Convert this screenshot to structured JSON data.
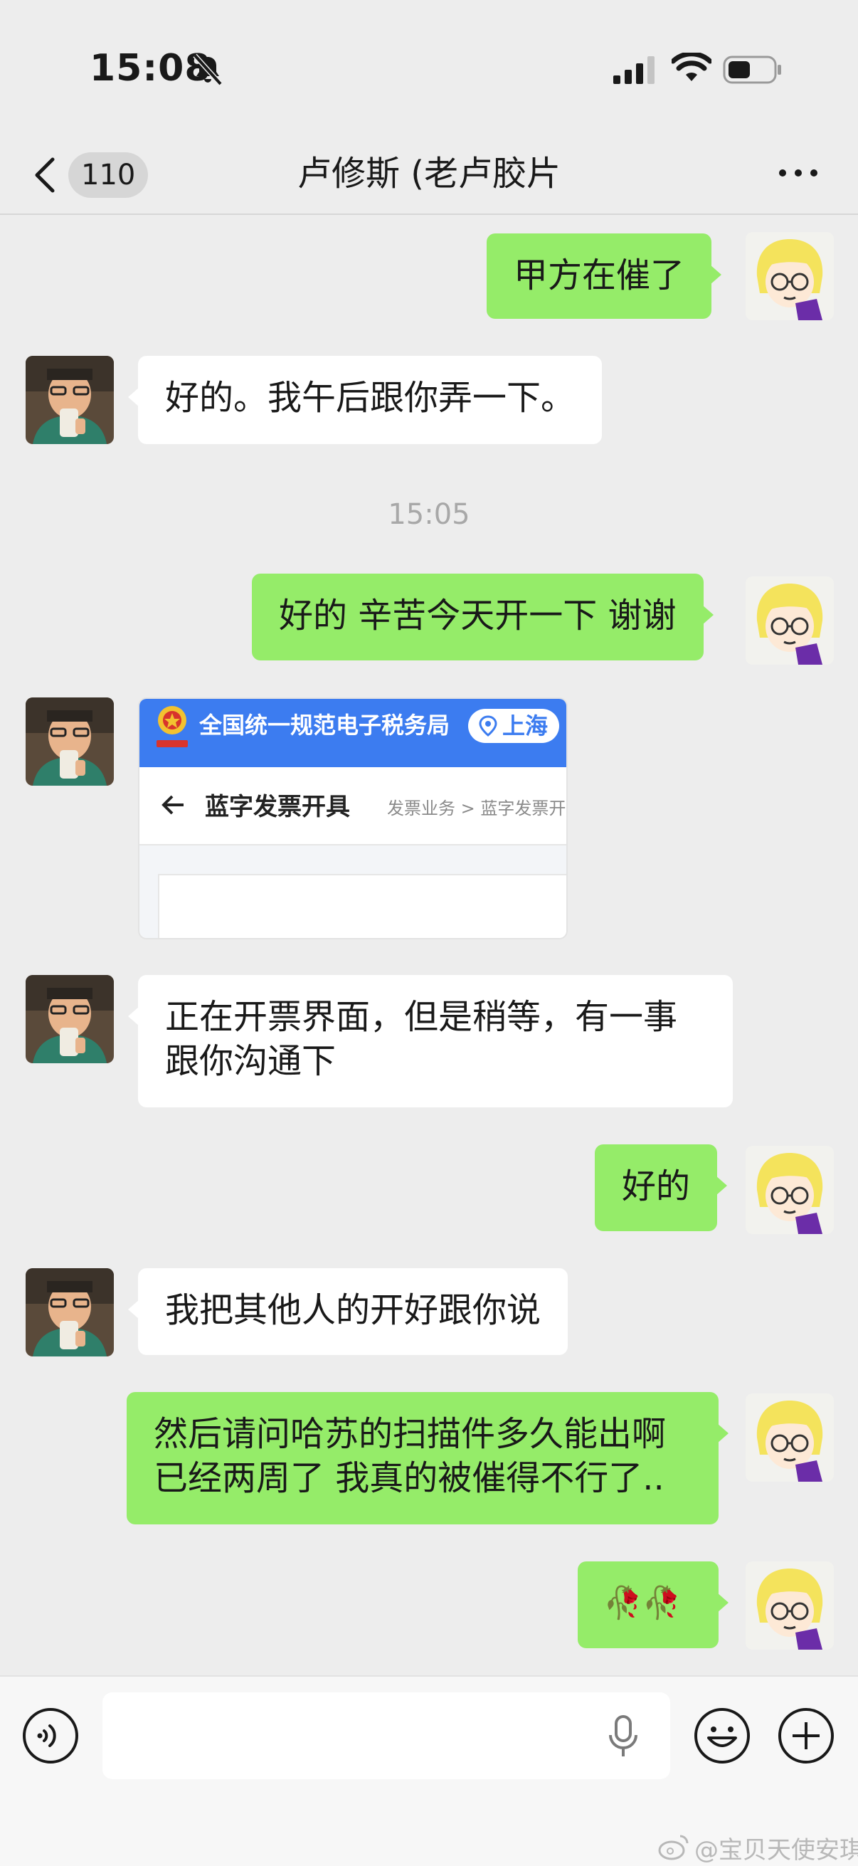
{
  "status_bar": {
    "time": "15:08"
  },
  "header": {
    "unread_count": "110",
    "title": "卢修斯 (老卢胶片"
  },
  "messages": [
    {
      "from": "me",
      "text": "甲方在催了"
    },
    {
      "from": "contact",
      "text": "好的。我午后跟你弄一下。"
    },
    {
      "type": "timestamp",
      "text": "15:05"
    },
    {
      "from": "me",
      "text": "好的 辛苦今天开一下 谢谢"
    },
    {
      "from": "contact",
      "type": "image"
    },
    {
      "from": "contact",
      "text": "正在开票界面，但是稍等，有一事\n跟你沟通下"
    },
    {
      "from": "me",
      "text": "好的"
    },
    {
      "from": "contact",
      "text": "我把其他人的开好跟你说"
    },
    {
      "from": "me",
      "text": "然后请问哈苏的扫描件多久能出啊\n已经两周了 我真的被催得不行了.."
    },
    {
      "from": "me",
      "type": "emoji",
      "text": "🥀🥀"
    }
  ],
  "shared_image": {
    "header_title": "全国统一规范电子税务局",
    "region": "上海",
    "page_title": "蓝字发票开具",
    "breadcrumb": "发票业务  >  蓝字发票开"
  },
  "input_bar": {
    "value": ""
  },
  "watermark": "@宝贝天使安琪",
  "colors": {
    "background": "#ededed",
    "outgoing_bubble": "#95ec69",
    "incoming_bubble": "#ffffff",
    "tax_header_blue": "#3c7cf0"
  },
  "icons": [
    "mute-bell-icon",
    "signal-icon",
    "wifi-icon",
    "battery-icon",
    "chevron-left-icon",
    "more-icon",
    "voice-icon",
    "mic-icon",
    "emoji-icon",
    "plus-icon",
    "weibo-icon"
  ]
}
